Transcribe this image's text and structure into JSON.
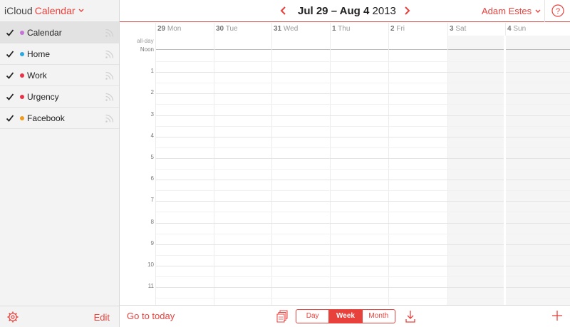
{
  "sidebar": {
    "brand_prefix": "iCloud",
    "brand_app": "Calendar",
    "calendars": [
      {
        "label": "Calendar",
        "color": "#c672d8",
        "checked": true,
        "selected": true
      },
      {
        "label": "Home",
        "color": "#2ea8de",
        "checked": true,
        "selected": false
      },
      {
        "label": "Work",
        "color": "#e8334b",
        "checked": true,
        "selected": false
      },
      {
        "label": "Urgency",
        "color": "#e8334b",
        "checked": true,
        "selected": false
      },
      {
        "label": "Facebook",
        "color": "#f19a1b",
        "checked": true,
        "selected": false
      }
    ],
    "edit_label": "Edit"
  },
  "header": {
    "range_bold": "Jul 29 – Aug 4",
    "range_year": "2013",
    "user_name": "Adam Estes"
  },
  "week": {
    "days": [
      {
        "num": "29",
        "name": "Mon"
      },
      {
        "num": "30",
        "name": "Tue"
      },
      {
        "num": "31",
        "name": "Wed"
      },
      {
        "num": "1",
        "name": "Thu"
      },
      {
        "num": "2",
        "name": "Fri"
      },
      {
        "num": "3",
        "name": "Sat"
      },
      {
        "num": "4",
        "name": "Sun"
      }
    ],
    "allday_label": "all-day",
    "hours": [
      "Noon",
      "1",
      "2",
      "3",
      "4",
      "5",
      "6",
      "7",
      "8",
      "9",
      "10",
      "11"
    ]
  },
  "footer": {
    "go_today": "Go to today",
    "views": [
      "Day",
      "Week",
      "Month"
    ],
    "active_view": "Week"
  },
  "colors": {
    "accent": "#e8413c"
  }
}
